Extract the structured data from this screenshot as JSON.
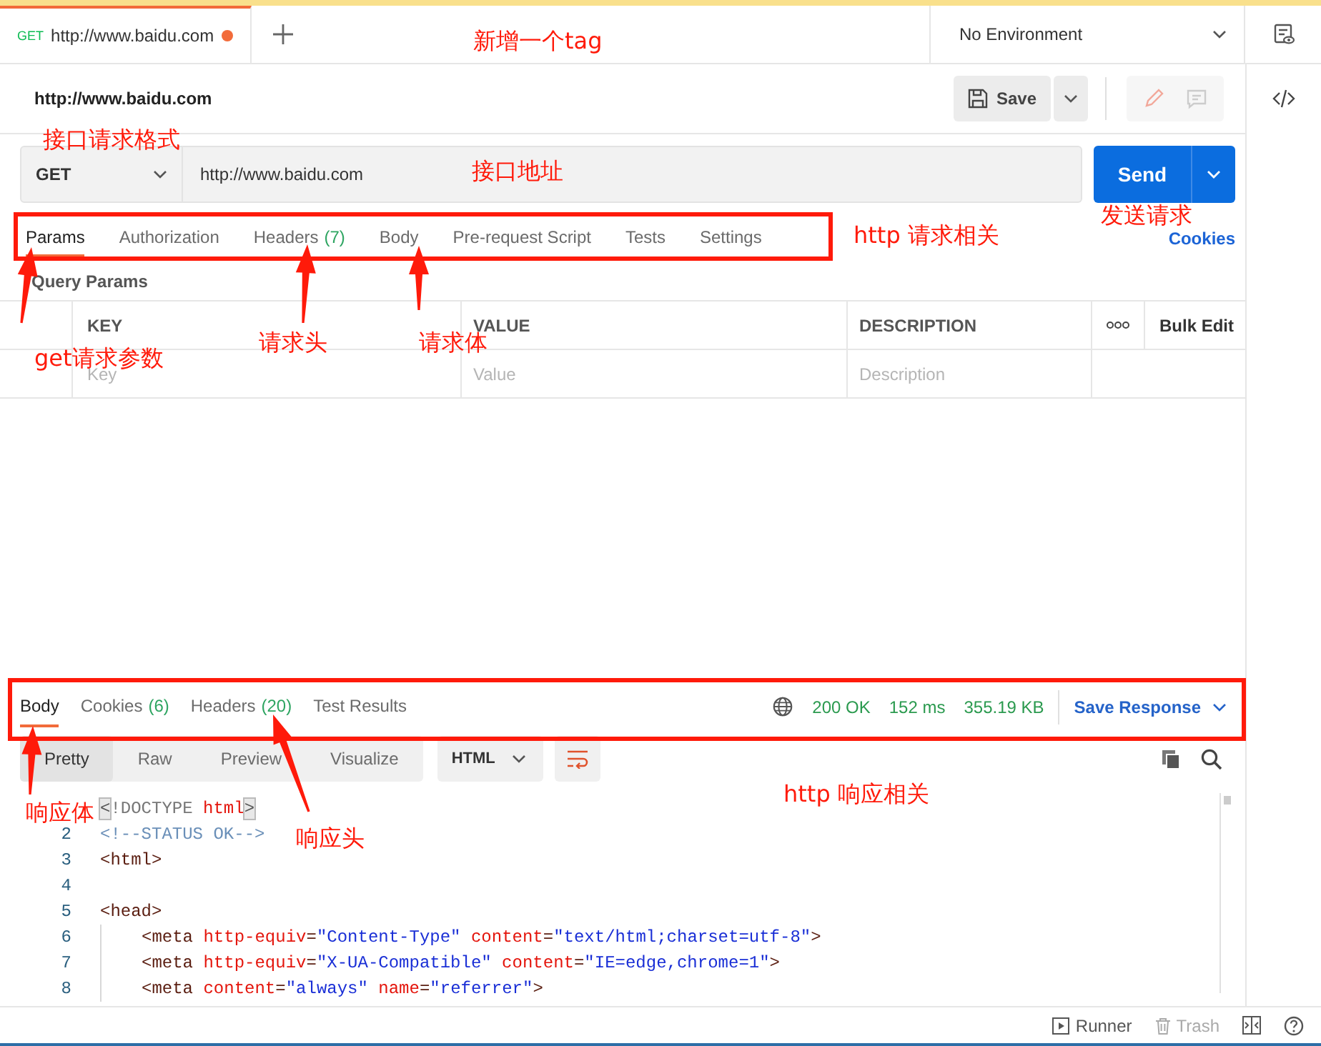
{
  "tabs": [
    {
      "method": "GET",
      "title": "http://www.baidu.com",
      "selected": true,
      "unsaved": true
    }
  ],
  "environment": "No Environment",
  "request": {
    "name": "http://www.baidu.com",
    "save": "Save",
    "method": "GET",
    "url": "http://www.baidu.com",
    "send": "Send"
  },
  "request_tabs": [
    {
      "label": "Params",
      "selected": true
    },
    {
      "label": "Authorization",
      "selected": false
    },
    {
      "label": "Headers",
      "count": "(7)",
      "selected": false
    },
    {
      "label": "Body",
      "selected": false
    },
    {
      "label": "Pre-request Script",
      "selected": false
    },
    {
      "label": "Tests",
      "selected": false
    },
    {
      "label": "Settings",
      "selected": false
    }
  ],
  "cookies_link": "Cookies",
  "query_params": {
    "title": "Query Params",
    "columns": [
      "KEY",
      "VALUE",
      "DESCRIPTION"
    ],
    "bulk_edit": "Bulk Edit",
    "placeholders": [
      "Key",
      "Value",
      "Description"
    ]
  },
  "response": {
    "tabs": [
      {
        "label": "Body",
        "selected": true
      },
      {
        "label": "Cookies",
        "count": "(6)",
        "selected": false
      },
      {
        "label": "Headers",
        "count": "(20)",
        "selected": false
      },
      {
        "label": "Test Results",
        "selected": false
      }
    ],
    "status": "200 OK",
    "time": "152 ms",
    "size": "355.19 KB",
    "save_response": "Save Response",
    "views": [
      {
        "label": "Pretty",
        "selected": true
      },
      {
        "label": "Raw",
        "selected": false
      },
      {
        "label": "Preview",
        "selected": false
      },
      {
        "label": "Visualize",
        "selected": false
      }
    ],
    "format": "HTML",
    "lines": [
      {
        "tokens": [
          {
            "kind": "match",
            "text": "<"
          },
          {
            "kind": "doctype",
            "text": "!DOCTYPE "
          },
          {
            "kind": "attr",
            "text": "html"
          },
          {
            "kind": "match",
            "text": ">"
          }
        ]
      },
      {
        "number": "2",
        "tokens": [
          {
            "kind": "comment",
            "text": "<!--STATUS OK-->"
          }
        ]
      },
      {
        "number": "3",
        "tokens": [
          {
            "kind": "tag",
            "text": "<html>"
          }
        ]
      },
      {
        "number": "4"
      },
      {
        "number": "5",
        "tokens": [
          {
            "kind": "tag",
            "text": "<head>"
          }
        ],
        "children": [
          {
            "number": "6",
            "tokens": [
              {
                "kind": "tag",
                "text": "<meta "
              },
              {
                "kind": "attr",
                "text": "http-equiv"
              },
              {
                "kind": "tag",
                "text": "="
              },
              {
                "kind": "string",
                "text": "\"Content-Type\""
              },
              {
                "kind": "attr",
                "text": " content"
              },
              {
                "kind": "tag",
                "text": "="
              },
              {
                "kind": "string",
                "text": "\"text/html;charset=utf-8\""
              },
              {
                "kind": "tag",
                "text": ">"
              }
            ]
          },
          {
            "number": "7",
            "tokens": [
              {
                "kind": "tag",
                "text": "<meta "
              },
              {
                "kind": "attr",
                "text": "http-equiv"
              },
              {
                "kind": "tag",
                "text": "="
              },
              {
                "kind": "string",
                "text": "\"X-UA-Compatible\""
              },
              {
                "kind": "attr",
                "text": " content"
              },
              {
                "kind": "tag",
                "text": "="
              },
              {
                "kind": "string",
                "text": "\"IE=edge,chrome=1\""
              },
              {
                "kind": "tag",
                "text": ">"
              }
            ]
          },
          {
            "number": "8",
            "tokens": [
              {
                "kind": "tag",
                "text": "<meta "
              },
              {
                "kind": "attr",
                "text": "content"
              },
              {
                "kind": "tag",
                "text": "="
              },
              {
                "kind": "string",
                "text": "\"always\""
              },
              {
                "kind": "attr",
                "text": " name"
              },
              {
                "kind": "tag",
                "text": "="
              },
              {
                "kind": "string",
                "text": "\"referrer\""
              },
              {
                "kind": "tag",
                "text": ">"
              }
            ]
          }
        ]
      }
    ]
  },
  "status_bar": {
    "runner": "Runner",
    "trash": "Trash"
  },
  "annotations": [
    "新增一个tag",
    "接口请求格式",
    "接口地址",
    "发送请求",
    "http 请求相关",
    "get请求参数",
    "请求头",
    "请求体",
    "响应体",
    "响应头",
    "http 响应相关"
  ]
}
